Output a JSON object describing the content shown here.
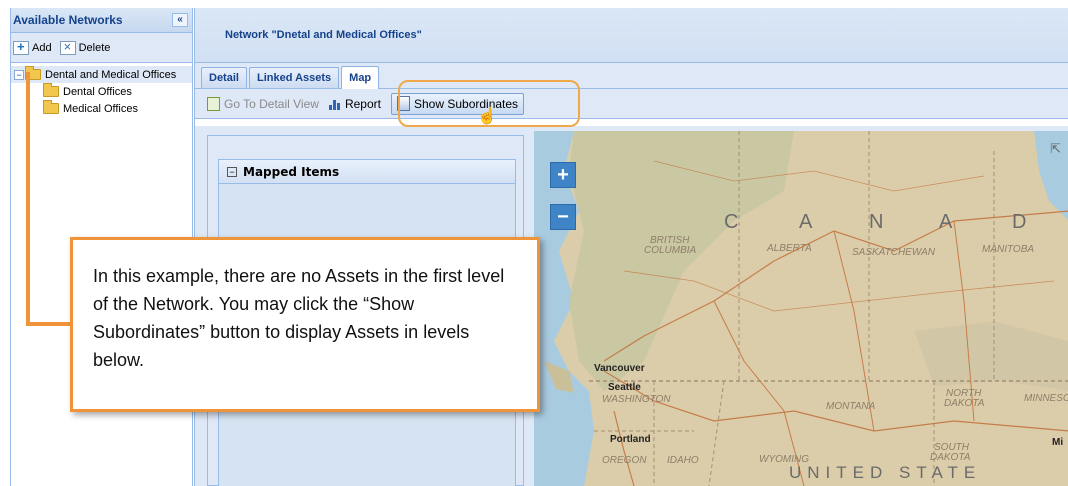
{
  "left_panel": {
    "title": "Available Networks",
    "collapse_glyph": "«",
    "toolbar": {
      "add_label": "Add",
      "delete_label": "Delete"
    },
    "tree": {
      "root": {
        "label": "Dental and Medical Offices",
        "toggle": "−",
        "icon": "folder-open-icon"
      },
      "children": [
        {
          "label": "Dental Offices",
          "icon": "folder-icon"
        },
        {
          "label": "Medical Offices",
          "icon": "folder-icon"
        }
      ]
    }
  },
  "main_panel": {
    "title": "Network \"Dnetal and Medical Offices\"",
    "tabs": [
      {
        "label": "Detail",
        "active": false
      },
      {
        "label": "Linked Assets",
        "active": false
      },
      {
        "label": "Map",
        "active": true
      }
    ],
    "actions": {
      "go_to_detail": "Go To Detail View",
      "report": "Report",
      "show_subordinates": "Show Subordinates"
    },
    "mapped_items": {
      "title": "Mapped Items",
      "toggle": "−"
    }
  },
  "map": {
    "zoom_in": "+",
    "zoom_out": "−",
    "expand_glyph": "⇱",
    "labels": {
      "c": "C",
      "a1": "A",
      "n": "N",
      "a2": "A",
      "d": "D",
      "british_columbia_1": "BRITISH",
      "british_columbia_2": "COLUMBIA",
      "alberta": "ALBERTA",
      "saskatchewan": "SASKATCHEWAN",
      "manitoba": "MANITOBA",
      "vancouver": "Vancouver",
      "seattle": "Seattle",
      "washington": "WASHINGTON",
      "montana": "MONTANA",
      "north_dakota_1": "NORTH",
      "north_dakota_2": "DAKOTA",
      "minnesota": "MINNESC",
      "portland": "Portland",
      "oregon": "OREGON",
      "idaho": "IDAHO",
      "wyoming": "WYOMING",
      "south_dakota_1": "SOUTH",
      "south_dakota_2": "DAKOTA",
      "mi": "Mi",
      "united_states": "UNITED   STATE"
    },
    "colors": {
      "land": "#dccdaa",
      "water": "#a9cbe0",
      "forest": "#c4c9a0",
      "roads": "#c47d4a"
    }
  },
  "callout": {
    "text": "In this example, there are no Assets in the first level of the Network. You may click the “Show Subordinates” button to display Assets in levels below.",
    "border_color": "#f0943a"
  }
}
